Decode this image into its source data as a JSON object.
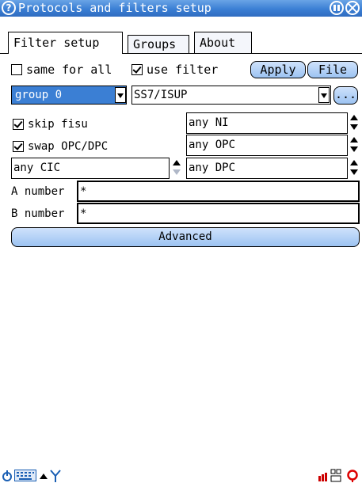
{
  "window": {
    "title": "Protocols and filters setup"
  },
  "tabs": [
    {
      "label": "Filter setup",
      "active": true
    },
    {
      "label": "Groups",
      "active": false
    },
    {
      "label": "About",
      "active": false
    }
  ],
  "options": {
    "same_for_all": {
      "label": "same for all",
      "checked": false
    },
    "use_filter": {
      "label": "use filter",
      "checked": true
    },
    "apply_label": "Apply",
    "file_label": "File"
  },
  "group_select": {
    "value": "group 0"
  },
  "protocol_select": {
    "value": "SS7/ISUP"
  },
  "more_label": "...",
  "filters": {
    "skip_fisu": {
      "label": "skip fisu",
      "checked": true
    },
    "swap_opc_dpc": {
      "label": "swap OPC/DPC",
      "checked": true
    },
    "ni": "any NI",
    "opc": "any OPC",
    "cic": "any CIC",
    "dpc": "any DPC",
    "a_number_label": "A number",
    "a_number_value": "*",
    "b_number_label": "B number",
    "b_number_value": "*",
    "advanced_label": "Advanced"
  },
  "colors": {
    "titlebar": "#3b7fd4",
    "button": "#9cc3f2",
    "selected": "#3b7fd4"
  },
  "statusbar": {
    "icons": [
      "power-icon",
      "keyboard-icon",
      "arrow-up-icon",
      "antenna-icon",
      "signal-icon",
      "network-icon",
      "lifebuoy-icon"
    ]
  }
}
